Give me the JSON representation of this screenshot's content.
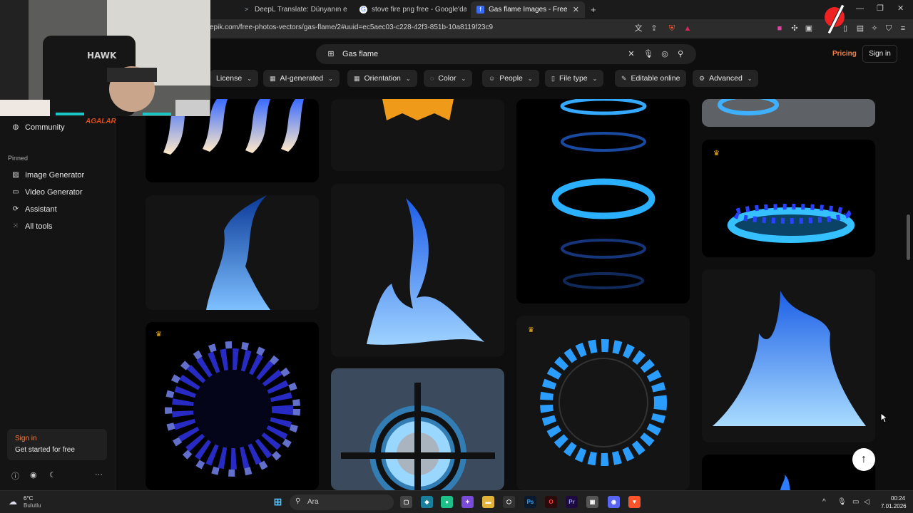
{
  "browser": {
    "tabs": [
      {
        "label": "DeepL Translate: Dünyanın en isabetl",
        "icon": "deepl-icon"
      },
      {
        "label": "stove fire png free - Google'da Ara",
        "icon": "google-icon"
      },
      {
        "label": "Gas flame Images - Free Downlo",
        "icon": "freepik-icon",
        "active": true
      }
    ],
    "url": "epik.com/free-photos-vectors/gas-flame/2#uuid=ec5aec03-c228-42f3-851b-10a8119f23c9"
  },
  "search": {
    "query": "Gas flame"
  },
  "header": {
    "pricing": "Pricing",
    "sign_in": "Sign in"
  },
  "filters": [
    {
      "label": "License",
      "icon": "license-icon"
    },
    {
      "label": "AI-generated",
      "icon": "ai-icon"
    },
    {
      "label": "Orientation",
      "icon": "orientation-icon"
    },
    {
      "label": "Color",
      "icon": "color-icon"
    },
    {
      "label": "People",
      "icon": "people-icon"
    },
    {
      "label": "File type",
      "icon": "file-icon"
    },
    {
      "label": "Editable online",
      "icon": "edit-icon"
    },
    {
      "label": "Advanced",
      "icon": "gear-icon"
    }
  ],
  "sidebar": {
    "community": "Community",
    "pinned_label": "Pinned",
    "pinned": [
      {
        "label": "Image Generator",
        "icon": "image-icon"
      },
      {
        "label": "Video Generator",
        "icon": "video-icon"
      },
      {
        "label": "Assistant",
        "icon": "assistant-icon"
      },
      {
        "label": "All tools",
        "icon": "grid-icon"
      }
    ],
    "signin_card": {
      "title": "Sign in",
      "subtitle": "Get started for free"
    }
  },
  "overlay": {
    "name": "AGALAR",
    "chair_brand": "HAWK"
  },
  "taskbar": {
    "weather_temp": "6°C",
    "weather_desc": "Bulutlu",
    "search_placeholder": "Ara",
    "time": "00:24",
    "date": "7.01.2026"
  },
  "colors": {
    "accent": "#f4834c",
    "flame_blue": "#2f8bff",
    "crown": "#f5b321"
  }
}
